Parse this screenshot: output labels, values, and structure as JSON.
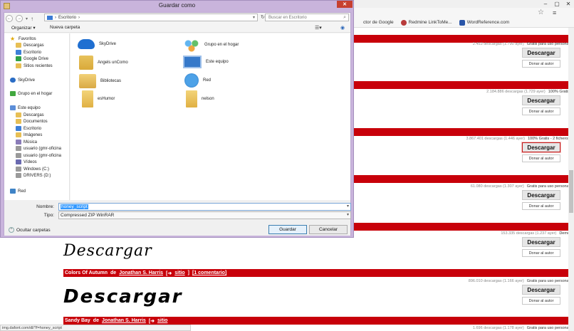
{
  "browser": {
    "bookmarks": [
      {
        "label": "ctor de Google",
        "color": "#3a7bd5"
      },
      {
        "label": "Redmine LinkToMe...",
        "color": "#b83b3b"
      },
      {
        "label": "WordReference.com",
        "color": "#2a55a8"
      }
    ],
    "status_url": "img.dafont.com/dl/?f=honey_script",
    "fonts": [
      {
        "meta": "2.453 descargas (1.790 ayer)",
        "license": "Gratis para uso personal",
        "download": "Descargar",
        "donate": "Donar al autor"
      },
      {
        "meta": "2.184.886 descargas (1.729 ayer)",
        "license": "100% Gratis",
        "download": "Descargar",
        "donate": "Donar al autor"
      },
      {
        "meta": "3.867.401 descargas (1.446 ayer)",
        "license": "100% Gratis - 2 ficheros",
        "download": "Descargar",
        "donate": "Donar al autor"
      },
      {
        "meta": "61.080 descargas (1.307 ayer)",
        "license": "Gratis para uso personal",
        "download": "Descargar",
        "donate": "Donar al autor"
      },
      {
        "meta": "153.335 descargas (1.237 ayer)",
        "license": "Demo",
        "download": "Descargar",
        "donate": "Donar al autor"
      },
      {
        "meta": "896.010 descargas (1.166 ayer)",
        "license": "Gratis para uso personal",
        "download": "Descargar",
        "donate": "Donar al autor"
      },
      {
        "meta": "1.696 descargas (1.178 ayer)",
        "license": "Gratis para uso personal",
        "download": "Descargar"
      }
    ],
    "section_colors": {
      "title": "Colors Of Autumn",
      "by": "de",
      "author": "Jonathan S. Harris",
      "site": "sitio",
      "comments": "[1 comentario]"
    },
    "section_sandy": {
      "title": "Sandy Bay",
      "by": "de",
      "author": "Jonathan S. Harris",
      "site": "sitio"
    },
    "previews": [
      "Descargar",
      "Descargar"
    ]
  },
  "dialog": {
    "title": "Guardar como",
    "path": {
      "separator": "›",
      "current": "Escritorio"
    },
    "search_placeholder": "Buscar en Escritorio",
    "organize": "Organizar ▾",
    "new_folder": "Nueva carpeta",
    "nav_pane": [
      {
        "label": "Favoritos",
        "icon": "star-icon",
        "level": 0
      },
      {
        "label": "Descargas",
        "icon": "downloads-folder-icon",
        "level": 1
      },
      {
        "label": "Escritorio",
        "icon": "desktop-folder-icon",
        "level": 1
      },
      {
        "label": "Google Drive",
        "icon": "google-drive-icon",
        "level": 1
      },
      {
        "label": "Sitios recientes",
        "icon": "recent-places-icon",
        "level": 1
      },
      {
        "label": "SkyDrive",
        "icon": "skydrive-icon",
        "level": 0
      },
      {
        "label": "Grupo en el hogar",
        "icon": "homegroup-icon",
        "level": 0
      },
      {
        "label": "Este equipo",
        "icon": "computer-icon",
        "level": 0
      },
      {
        "label": "Descargas",
        "icon": "downloads-folder-icon",
        "level": 1
      },
      {
        "label": "Documentos",
        "icon": "documents-folder-icon",
        "level": 1
      },
      {
        "label": "Escritorio",
        "icon": "desktop-folder-icon",
        "level": 1
      },
      {
        "label": "Imágenes",
        "icon": "pictures-folder-icon",
        "level": 1
      },
      {
        "label": "Música",
        "icon": "music-folder-icon",
        "level": 1
      },
      {
        "label": "usuario (gmr-oficina",
        "icon": "network-drive-icon",
        "level": 1
      },
      {
        "label": "usuario (gmr-oficina",
        "icon": "network-drive-icon",
        "level": 1
      },
      {
        "label": "Vídeos",
        "icon": "videos-folder-icon",
        "level": 1
      },
      {
        "label": "Windows (C:)",
        "icon": "hard-drive-icon",
        "level": 1
      },
      {
        "label": "DRIVERS (D:)",
        "icon": "hard-drive-icon",
        "level": 1
      },
      {
        "label": "Red",
        "icon": "network-icon",
        "level": 0
      }
    ],
    "files": [
      {
        "label": "SkyDrive",
        "icon": "sky"
      },
      {
        "label": "Grupo en el hogar",
        "icon": "home"
      },
      {
        "label": "Angels unComo",
        "icon": "user"
      },
      {
        "label": "Este equipo",
        "icon": "pcbig"
      },
      {
        "label": "Bibliotecas",
        "icon": "lib"
      },
      {
        "label": "Red",
        "icon": "globe"
      },
      {
        "label": "esHumor",
        "icon": "fold"
      },
      {
        "label": "nelson",
        "icon": "fold"
      }
    ],
    "filename_label": "Nombre:",
    "filename_value": "honey_script",
    "type_label": "Tipo:",
    "type_value": "Compressed ZIP WinRAR",
    "hide_folders": "Ocultar carpetas",
    "save": "Guardar",
    "cancel": "Cancelar"
  }
}
